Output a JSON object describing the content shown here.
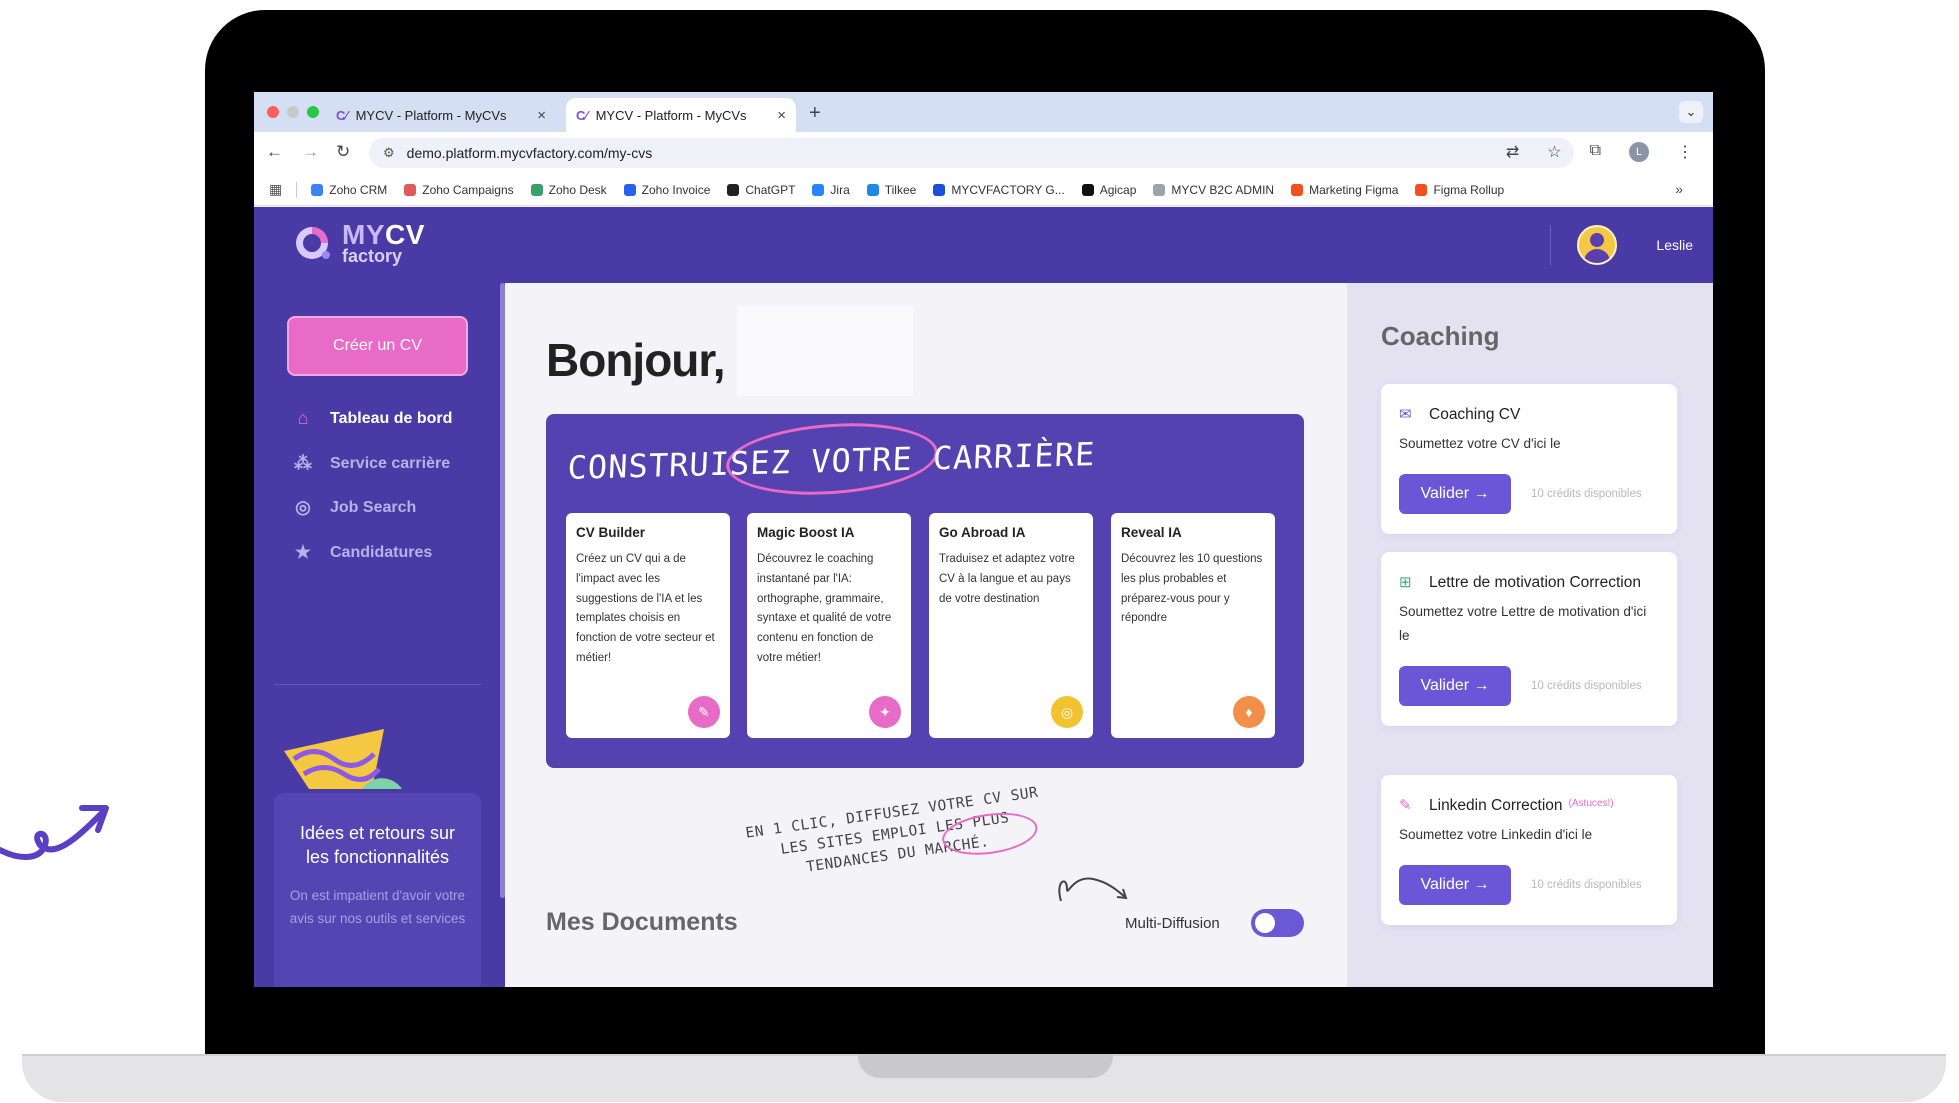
{
  "browser": {
    "tabs": [
      {
        "title": "MYCV - Platform - MyCVs",
        "close": "×"
      },
      {
        "title": "MYCV - Platform - MyCVs",
        "close": "×"
      }
    ],
    "new_tab": "+",
    "tab_menu": "⌄",
    "url": "demo.platform.mycvfactory.com/my-cvs",
    "profile_initial": "L",
    "bookmarks": [
      {
        "label": "Zoho CRM",
        "color": "#3b82f6"
      },
      {
        "label": "Zoho Campaigns",
        "color": "#e05a5a"
      },
      {
        "label": "Zoho Desk",
        "color": "#38a169"
      },
      {
        "label": "Zoho Invoice",
        "color": "#2563eb"
      },
      {
        "label": "ChatGPT",
        "color": "#222222"
      },
      {
        "label": "Jira",
        "color": "#2684ff"
      },
      {
        "label": "Tilkee",
        "color": "#1e88e5"
      },
      {
        "label": "MYCVFACTORY G...",
        "color": "#1d4ed8"
      },
      {
        "label": "Agicap",
        "color": "#111111"
      },
      {
        "label": "MYCV B2C ADMIN",
        "color": "#9ca3af"
      },
      {
        "label": "Marketing Figma",
        "color": "#f24e1e"
      },
      {
        "label": "Figma Rollup",
        "color": "#f24e1e"
      }
    ],
    "bookmarks_more": "»"
  },
  "header": {
    "logo_line1_a": "MY",
    "logo_line1_b": "CV",
    "logo_line2": "factory",
    "user_name": "Leslie"
  },
  "sidebar": {
    "create_button": "Créer un CV",
    "nav": [
      {
        "label": "Tableau de bord",
        "icon": "home-icon"
      },
      {
        "label": "Service carrière",
        "icon": "network-icon"
      },
      {
        "label": "Job Search",
        "icon": "target-icon"
      },
      {
        "label": "Candidatures",
        "icon": "star-icon"
      }
    ],
    "feedback_title": "Idées et retours sur les fonctionnalités",
    "feedback_text": "On est impatient d'avoir votre avis sur nos outils et services"
  },
  "main": {
    "greeting": "Bonjour,",
    "hero_title": "CONSTRUISEZ VOTRE CARRIÈRE",
    "features": [
      {
        "title": "CV Builder",
        "desc": "Créez un CV qui a de l'impact avec les suggestions de l'IA et les templates choisis en fonction de votre secteur et métier!",
        "badge": "✎",
        "color": "#e96bc8"
      },
      {
        "title": "Magic Boost IA",
        "desc": "Découvrez le coaching instantané par l'IA: orthographe, grammaire, syntaxe et qualité de votre contenu en fonction de votre métier!",
        "badge": "✦",
        "color": "#e96bc8"
      },
      {
        "title": "Go Abroad IA",
        "desc": "Traduisez et adaptez votre CV à la langue et au pays de votre destination",
        "badge": "◎",
        "color": "#f2c230"
      },
      {
        "title": "Reveal IA",
        "desc": "Découvrez les 10 questions les plus probables et préparez-vous pour y répondre",
        "badge": "♦",
        "color": "#f2904a"
      }
    ],
    "hand_note": "EN 1 CLIC, DIFFUSEZ VOTRE CV SUR LES SITES EMPLOI LES PLUS TENDANCES DU MARCHÉ.",
    "documents_title": "Mes Documents",
    "multi_diffusion_label": "Multi-Diffusion",
    "multi_diffusion_on": false
  },
  "coaching": {
    "title": "Coaching",
    "cards": [
      {
        "title": "Coaching CV",
        "tag": "",
        "desc": "Soumettez votre CV d'ici le",
        "button": "Valider →",
        "credits": "10 crédits disponibles",
        "icon": "megaphone-icon"
      },
      {
        "title": "Lettre de motivation Correction",
        "tag": "",
        "desc": "Soumettez votre Lettre de motivation d'ici le",
        "button": "Valider →",
        "credits": "10 crédits disponibles",
        "icon": "grid-icon"
      },
      {
        "title": "Linkedin Correction",
        "tag": "(Astuces!)",
        "desc": "Soumettez votre Linkedin d'ici le",
        "button": "Valider →",
        "credits": "10 crédits disponibles",
        "icon": "pencil-icon"
      }
    ]
  }
}
